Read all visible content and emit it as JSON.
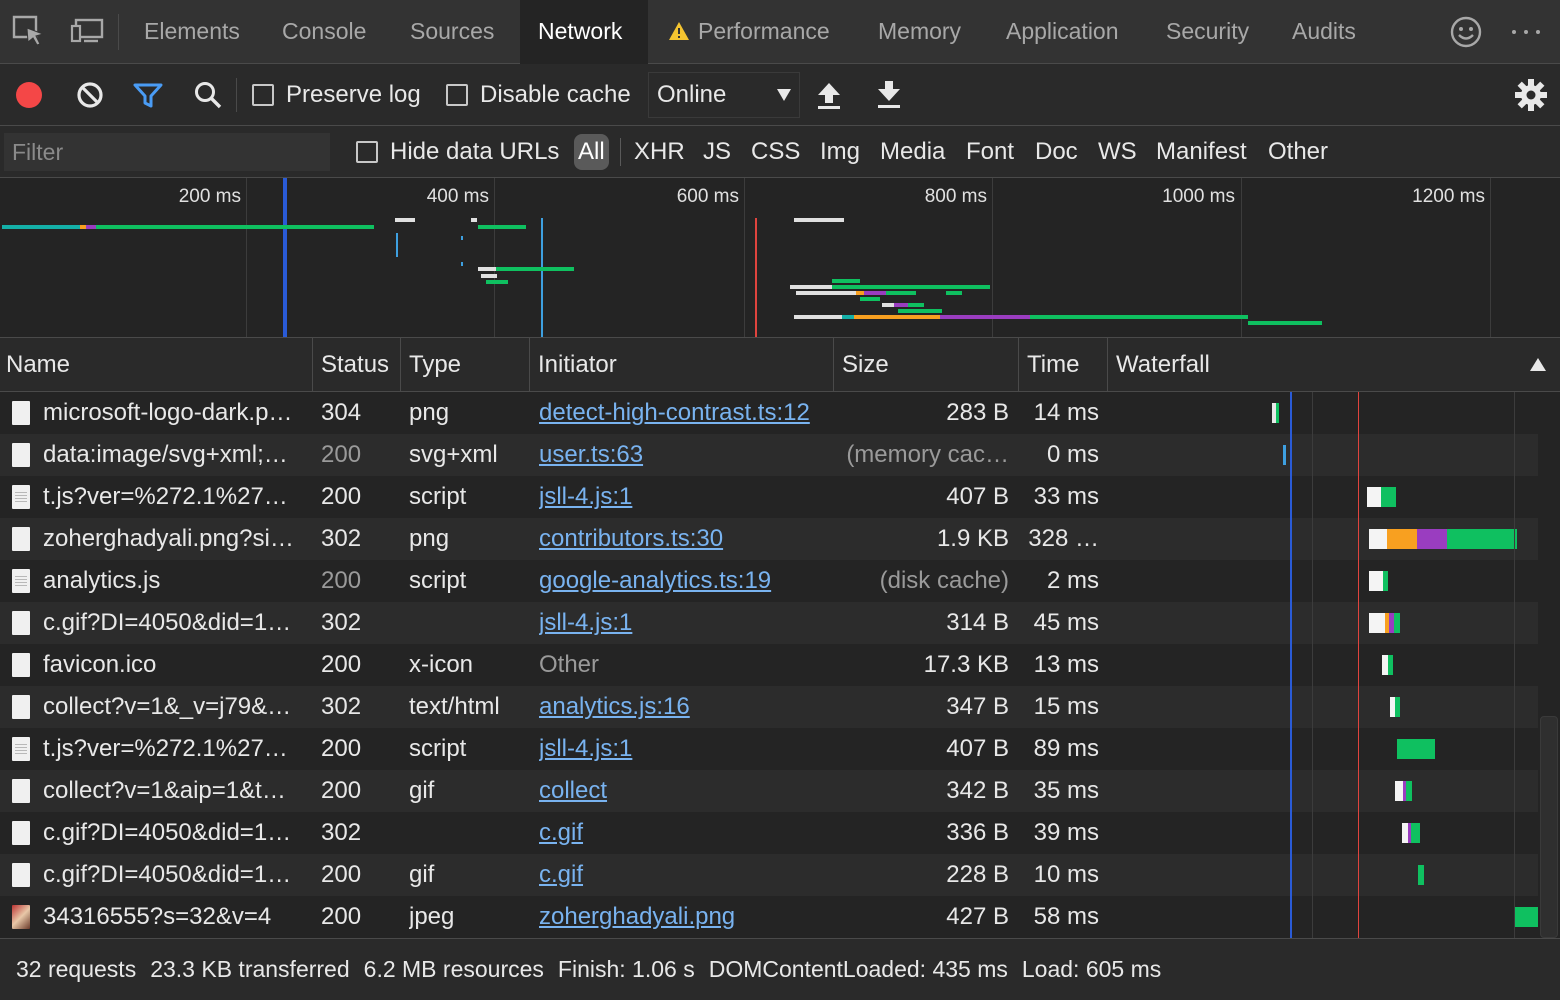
{
  "tabs": [
    {
      "label": "Elements"
    },
    {
      "label": "Console"
    },
    {
      "label": "Sources"
    },
    {
      "label": "Network"
    },
    {
      "label": "Performance"
    },
    {
      "label": "Memory"
    },
    {
      "label": "Application"
    },
    {
      "label": "Security"
    },
    {
      "label": "Audits"
    }
  ],
  "toolbar": {
    "preserve_log": "Preserve log",
    "disable_cache": "Disable cache",
    "throttling": "Online"
  },
  "filter": {
    "placeholder": "Filter",
    "hide_data_urls": "Hide data URLs",
    "types": [
      "All",
      "XHR",
      "JS",
      "CSS",
      "Img",
      "Media",
      "Font",
      "Doc",
      "WS",
      "Manifest",
      "Other"
    ]
  },
  "overview": {
    "ticks": [
      "200 ms",
      "400 ms",
      "600 ms",
      "800 ms",
      "1000 ms",
      "1200 ms"
    ]
  },
  "columns": {
    "name": "Name",
    "status": "Status",
    "type": "Type",
    "initiator": "Initiator",
    "size": "Size",
    "time": "Time",
    "waterfall": "Waterfall"
  },
  "rows": [
    {
      "name": "microsoft-logo-dark.p…",
      "status": "304",
      "type": "png",
      "initiator": "detect-high-contrast.ts:12",
      "size": "283 B",
      "time": "14 ms"
    },
    {
      "name": "data:image/svg+xml;…",
      "status": "200",
      "type": "svg+xml",
      "initiator": "user.ts:63",
      "size": "(memory cac…",
      "time": "0 ms"
    },
    {
      "name": "t.js?ver=%272.1%27…",
      "status": "200",
      "type": "script",
      "initiator": "jsll-4.js:1",
      "size": "407 B",
      "time": "33 ms"
    },
    {
      "name": "zoherghadyali.png?si…",
      "status": "302",
      "type": "png",
      "initiator": "contributors.ts:30",
      "size": "1.9 KB",
      "time": "328 …"
    },
    {
      "name": "analytics.js",
      "status": "200",
      "type": "script",
      "initiator": "google-analytics.ts:19",
      "size": "(disk cache)",
      "time": "2 ms"
    },
    {
      "name": "c.gif?DI=4050&did=1…",
      "status": "302",
      "type": "",
      "initiator": "jsll-4.js:1",
      "size": "314 B",
      "time": "45 ms"
    },
    {
      "name": "favicon.ico",
      "status": "200",
      "type": "x-icon",
      "initiator": "Other",
      "size": "17.3 KB",
      "time": "13 ms"
    },
    {
      "name": "collect?v=1&_v=j79&…",
      "status": "302",
      "type": "text/html",
      "initiator": "analytics.js:16",
      "size": "347 B",
      "time": "15 ms"
    },
    {
      "name": "t.js?ver=%272.1%27…",
      "status": "200",
      "type": "script",
      "initiator": "jsll-4.js:1",
      "size": "407 B",
      "time": "89 ms"
    },
    {
      "name": "collect?v=1&aip=1&t…",
      "status": "200",
      "type": "gif",
      "initiator": "collect",
      "size": "342 B",
      "time": "35 ms"
    },
    {
      "name": "c.gif?DI=4050&did=1…",
      "status": "302",
      "type": "",
      "initiator": "c.gif",
      "size": "336 B",
      "time": "39 ms"
    },
    {
      "name": "c.gif?DI=4050&did=1…",
      "status": "200",
      "type": "gif",
      "initiator": "c.gif",
      "size": "228 B",
      "time": "10 ms"
    },
    {
      "name": "34316555?s=32&v=4",
      "status": "200",
      "type": "jpeg",
      "initiator": "zoherghadyali.png",
      "size": "427 B",
      "time": "58 ms"
    }
  ],
  "status": {
    "requests": "32 requests",
    "transferred": "23.3 KB transferred",
    "resources": "6.2 MB resources",
    "finish": "Finish: 1.06 s",
    "dom": "DOMContentLoaded: 435 ms",
    "load": "Load: 605 ms"
  },
  "colors": {
    "accent_blue": "#4a9cf5",
    "record_red": "#f44747",
    "dom_line": "#2a5bd7",
    "load_line": "#e0443e",
    "bar_green": "#0fc060",
    "bar_orange": "#f8a020",
    "bar_purple": "#9a3dc0",
    "bar_teal": "#14b0a8"
  }
}
